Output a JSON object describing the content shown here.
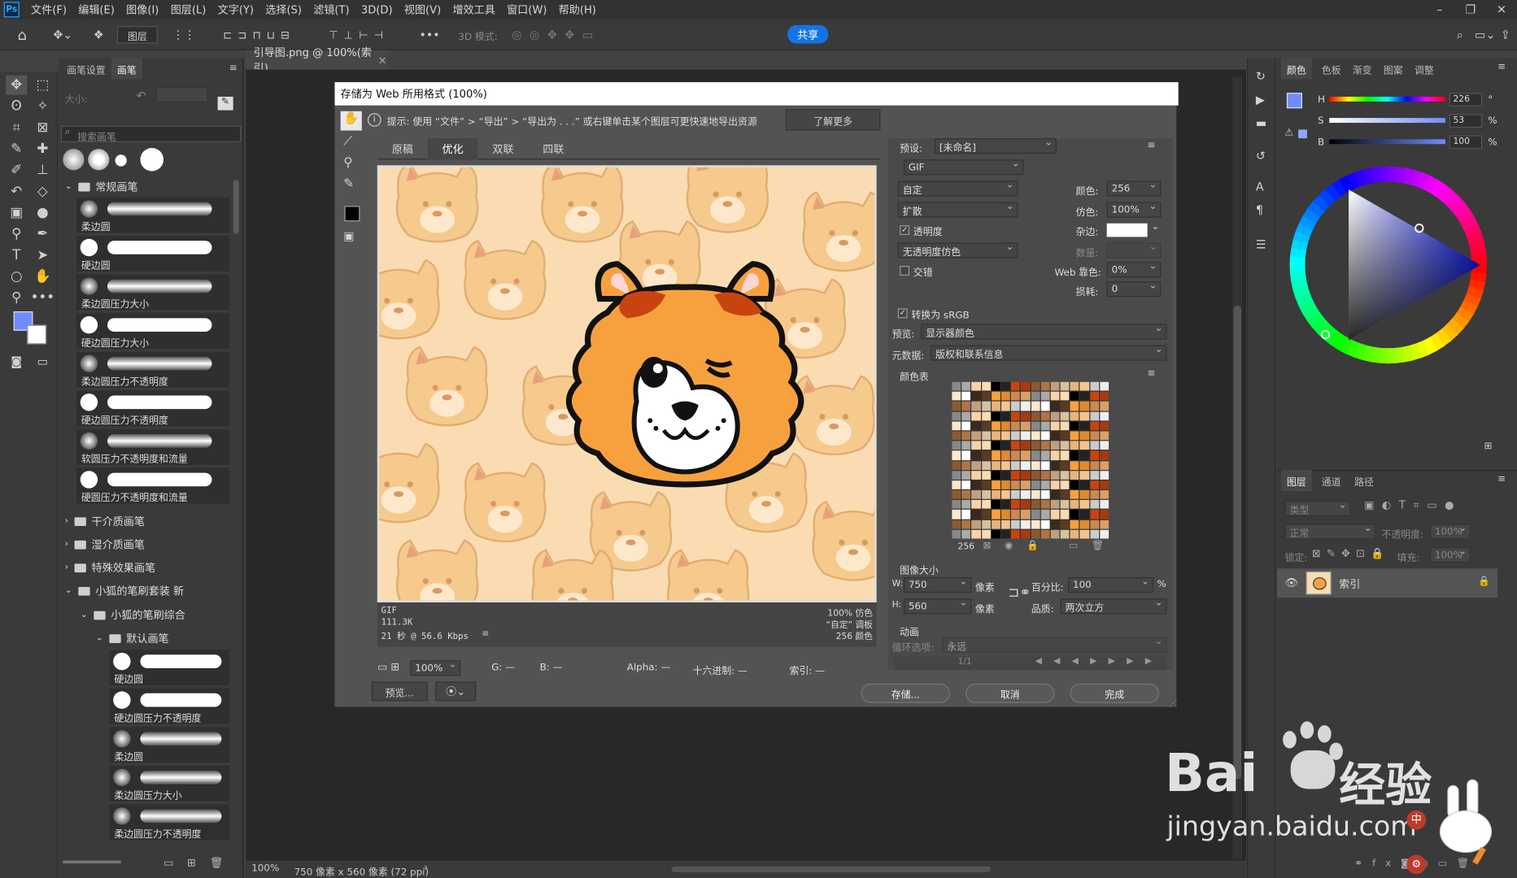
{
  "app": {
    "logo": "Ps"
  },
  "menu": [
    "文件(F)",
    "编辑(E)",
    "图像(I)",
    "图层(L)",
    "文字(Y)",
    "选择(S)",
    "滤镜(T)",
    "3D(D)",
    "视图(V)",
    "增效工具",
    "窗口(W)",
    "帮助(H)"
  ],
  "optionsbar": {
    "layer_select": "图层",
    "mode3d": "3D 模式:",
    "share": "共享"
  },
  "brush_panel": {
    "tabs": [
      "画笔设置",
      "画笔"
    ],
    "size_label": "大小:",
    "search_placeholder": "搜索画笔",
    "group1": "常规画笔",
    "brushes1": [
      "柔边圆",
      "硬边圆",
      "柔边圆压力大小",
      "硬边圆压力大小",
      "柔边圆压力不透明度",
      "硬边圆压力不透明度",
      "软圆压力不透明度和流量",
      "硬圆压力不透明度和流量"
    ],
    "groups": [
      "干介质画笔",
      "湿介质画笔",
      "特殊效果画笔",
      "小狐的笔刷套装 新"
    ],
    "subgroup": "小狐的笔刷综合",
    "subsubgroup": "默认画笔",
    "brushes2": [
      "硬边圆",
      "硬边圆压力不透明度",
      "柔边圆",
      "柔边圆压力大小",
      "柔边圆压力不透明度"
    ]
  },
  "document": {
    "tab": "引导图.png @ 100%(索引)",
    "zoom": "100%",
    "info": "750 像素 x 560 像素 (72 ppi)"
  },
  "dialog": {
    "title": "存储为 Web 所用格式 (100%)",
    "hint": "提示:  使用 “文件” > “导出” > “导出为 . . .” 或右键单击某个图层可更快速地导出资源",
    "learn_more": "了解更多",
    "view_tabs": [
      "原稿",
      "优化",
      "双联",
      "四联"
    ],
    "preview_info": {
      "format": "GIF",
      "size": "111.3K",
      "time": "21 秒 @ 56.6 Kbps",
      "dither": "100% 仿色",
      "palette": "“自定” 调板",
      "colors": "256 颜色"
    },
    "bottom": {
      "zoom": "100%",
      "r": "G: —",
      "b": "B: —",
      "alpha": "Alpha: —",
      "hex": "十六进制: —",
      "index": "索引: —"
    },
    "buttons": {
      "preview": "预览...",
      "save": "存储...",
      "cancel": "取消",
      "done": "完成"
    },
    "settings": {
      "preset_label": "预设:",
      "preset": "[未命名]",
      "format": "GIF",
      "reduction": "自定",
      "colors_label": "颜色:",
      "colors": "256",
      "dither_algo": "扩散",
      "dither_label": "仿色:",
      "dither": "100%",
      "transparency": "透明度",
      "matte_label": "杂边:",
      "trans_dither": "无透明度仿色",
      "amount_label": "数量:",
      "interlaced": "交错",
      "websnap_label": "Web 靠色:",
      "websnap": "0%",
      "lossy_label": "损耗:",
      "lossy": "0",
      "srgb": "转换为 sRGB",
      "preview_label": "预览:",
      "preview_val": "显示器颜色",
      "meta_label": "元数据:",
      "meta_val": "版权和联系信息",
      "colortable": "颜色表",
      "count": "256",
      "imagesize": "图像大小",
      "w_label": "W:",
      "w": "750",
      "h_label": "H:",
      "h": "560",
      "px": "像素",
      "pct_label": "百分比:",
      "pct": "100",
      "pct_unit": "%",
      "quality_label": "品质:",
      "quality": "两次立方",
      "anim": "动画",
      "loop_label": "循环选项:",
      "loop": "永远",
      "frame": "1/1"
    }
  },
  "color_panel": {
    "tabs": [
      "颜色",
      "色板",
      "渐变",
      "图案",
      "调整"
    ],
    "h": "226",
    "s": "53",
    "b": "100",
    "h_unit": "°",
    "s_unit": "%",
    "b_unit": "%"
  },
  "layers_panel": {
    "tabs": [
      "图层",
      "通道",
      "路径"
    ],
    "filter": "类型",
    "blend": "正常",
    "opacity_label": "不透明度:",
    "opacity": "100%",
    "lock_label": "锁定:",
    "fill_label": "填充:",
    "fill": "100%",
    "layer_name": "索引"
  },
  "watermark": {
    "text1": "Bai",
    "text2": "经验",
    "url": "jingyan.baidu.com"
  }
}
